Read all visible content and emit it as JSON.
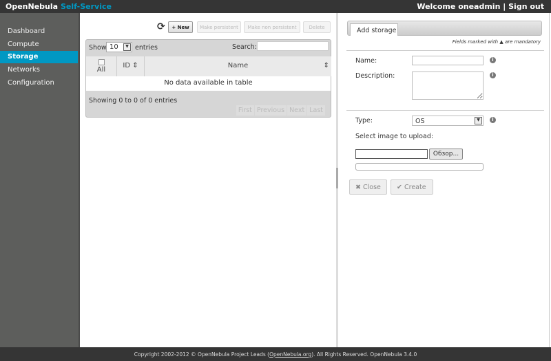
{
  "header": {
    "brand": "OpenNebula",
    "brand_sub": "Self-Service",
    "welcome": "Welcome",
    "user": "oneadmin",
    "separator": "|",
    "signout": "Sign out"
  },
  "sidebar": {
    "items": [
      {
        "label": "Dashboard"
      },
      {
        "label": "Compute"
      },
      {
        "label": "Storage",
        "active": true
      },
      {
        "label": "Networks"
      },
      {
        "label": "Configuration"
      }
    ]
  },
  "toolbar": {
    "new": "+ New",
    "make_persistent": "Make persistent",
    "make_non_persistent": "Make non persistent",
    "delete": "Delete"
  },
  "table": {
    "show": "Show",
    "length": "10",
    "entries": "entries",
    "search": "Search:",
    "search_value": "",
    "columns": [
      "All",
      "ID",
      "Name"
    ],
    "empty": "No data available in table",
    "info": "Showing 0 to 0 of 0 entries",
    "pager": [
      "First",
      "Previous",
      "Next",
      "Last"
    ]
  },
  "form": {
    "tab": "Add storage",
    "mandatory_pre": "Fields marked with",
    "mandatory_post": "are mandatory",
    "name_label": "Name:",
    "name_value": "",
    "desc_label": "Description:",
    "desc_value": "",
    "type_label": "Type:",
    "type_value": "OS",
    "upload_label": "Select image to upload:",
    "browse": "Обзор...",
    "close": "Close",
    "create": "Create"
  },
  "footer": {
    "pre": "Copyright 2002-2012 © OpenNebula Project Leads (",
    "link": "OpenNebula.org",
    "post": "). All Rights Reserved. OpenNebula 3.4.0"
  },
  "colors": {
    "accent": "#0098c3",
    "header": "#353535",
    "sidebar": "#5d5e5c"
  }
}
